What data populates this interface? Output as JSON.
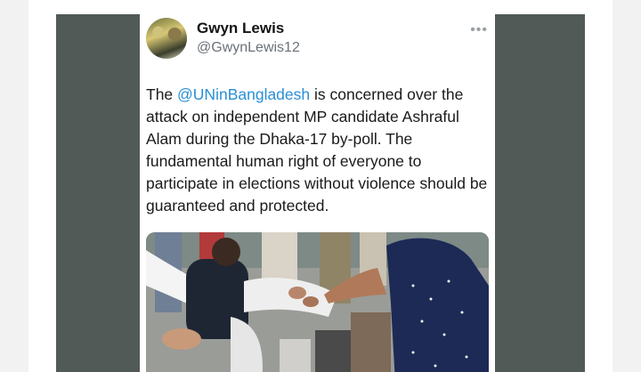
{
  "tweet": {
    "author_name": "Gwyn Lewis",
    "author_handle": "@GwynLewis12",
    "more_icon": "more-horizontal-icon",
    "text_before": "The ",
    "mention": "@UNinBangladesh",
    "text_after": " is concerned over the attack on independent MP candidate Ashraful Alam during the Dhaka-17 by-poll. The fundamental human right of everyone to participate in elections without violence should be guaranteed and protected.",
    "mention_color": "#2a8fd6"
  }
}
